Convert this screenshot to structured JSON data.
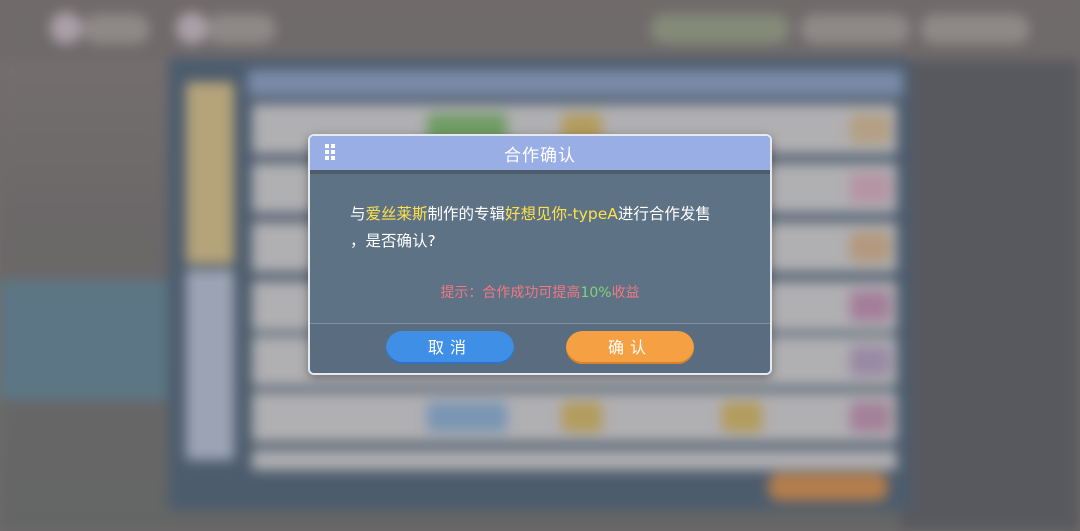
{
  "dialog": {
    "title": "合作确认",
    "message": {
      "prefix": "与",
      "partner": "爱丝莱斯",
      "middle": "制作的专辑",
      "album": "好想见你-typeA",
      "suffix": "进行合作发售",
      "line2": "，是否确认?"
    },
    "tip": {
      "prefix": "提示：合作成功可提高",
      "percent": "10%",
      "suffix": "收益"
    },
    "cancel_label": "取消",
    "confirm_label": "确认"
  },
  "colors": {
    "title_bar": "#9aaee6",
    "highlight": "#ffe14a",
    "tip": "#f07880",
    "tip_percent": "#7fd47a",
    "cancel_button": "#3f8fe6",
    "confirm_button": "#f5a043"
  }
}
